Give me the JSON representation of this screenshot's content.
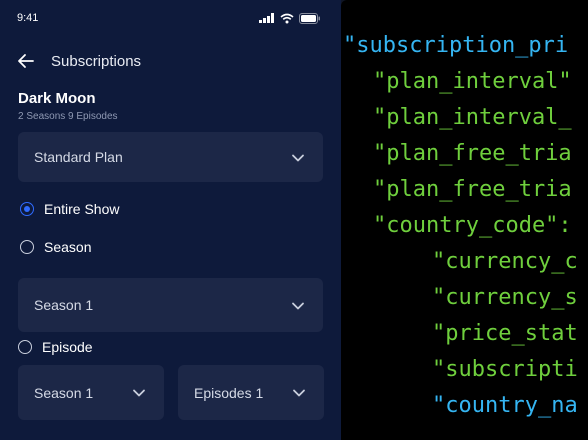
{
  "status_bar": {
    "time": "9:41"
  },
  "header": {
    "title": "Subscriptions"
  },
  "show": {
    "title": "Dark Moon",
    "meta": "2 Seasons 9 Episodes"
  },
  "plan_select": {
    "value": "Standard Plan"
  },
  "options": {
    "entire_show": "Entire Show",
    "season": "Season",
    "episode": "Episode",
    "selected": "entire_show"
  },
  "season_select": {
    "value": "Season 1"
  },
  "episode_season_select": {
    "value": "Season 1"
  },
  "episode_select": {
    "value": "Episodes 1"
  },
  "code": {
    "lines": [
      "\"subscription_pri",
      "\"plan_interval\"",
      "\"plan_interval_",
      "\"plan_free_tria",
      "\"plan_free_tria",
      "\"country_code\":",
      "\"currency_c",
      "\"currency_s",
      "\"price_stat",
      "\"subscripti",
      "\"country_na"
    ]
  },
  "colors": {
    "phone_bg": "#0e1a3b",
    "select_bg": "#1c2747",
    "radio_active": "#2f6bff",
    "code_blue": "#35b5f2",
    "code_green": "#6fcf3d"
  }
}
